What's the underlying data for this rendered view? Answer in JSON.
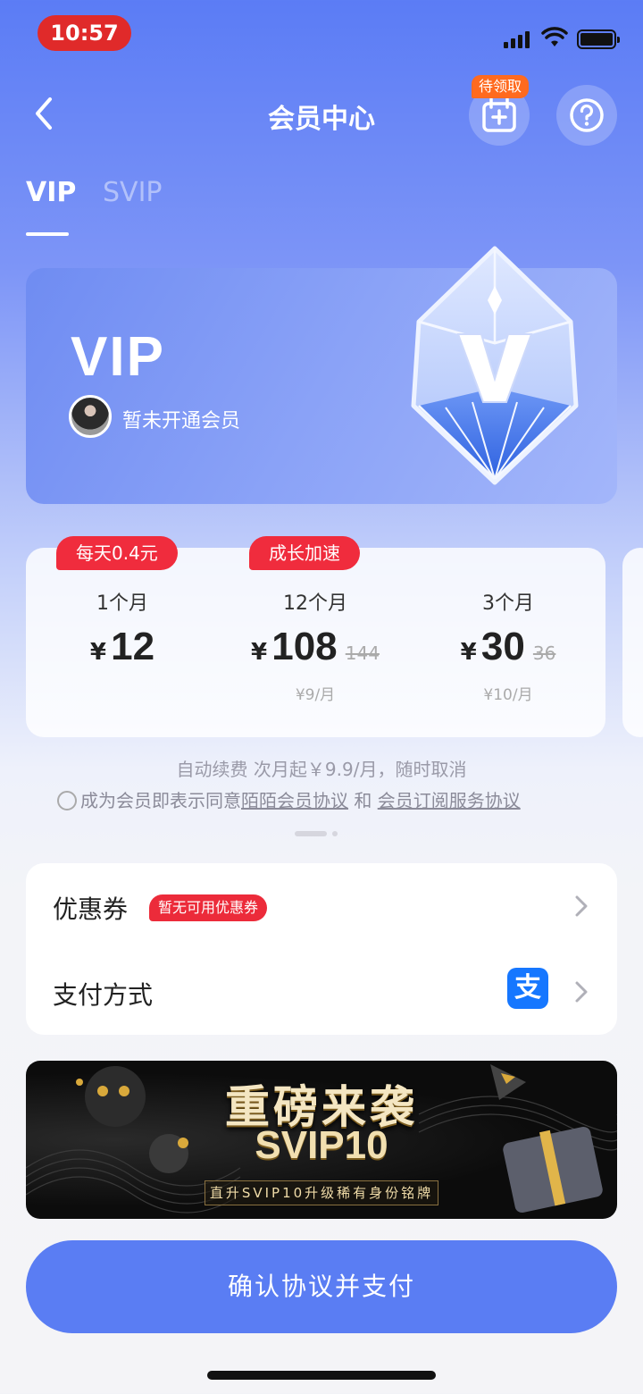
{
  "status_bar": {
    "time": "10:57"
  },
  "header": {
    "title": "会员中心",
    "calendar_badge": "待领取"
  },
  "tabs": [
    {
      "label": "VIP"
    },
    {
      "label": "SVIP"
    }
  ],
  "vip_card": {
    "title": "VIP",
    "member_status": "暂未开通会员"
  },
  "plans": [
    {
      "badge": "每天0.4元",
      "duration": "1个月",
      "currency": "¥",
      "price": "12",
      "original_price": "",
      "monthly": ""
    },
    {
      "badge": "成长加速",
      "duration": "12个月",
      "currency": "¥",
      "price": "108",
      "original_price": "144",
      "monthly": "¥9/月"
    },
    {
      "badge": "",
      "duration": "3个月",
      "currency": "¥",
      "price": "30",
      "original_price": "36",
      "monthly": "¥10/月"
    }
  ],
  "renewal_note": "自动续费 次月起￥9.9/月，随时取消",
  "agreement": {
    "prefix": "成为会员即表示同意",
    "link1": "陌陌会员协议",
    "conjunction": " 和 ",
    "link2": "会员订阅服务协议"
  },
  "options": {
    "coupon_label": "优惠券",
    "coupon_tag": "暂无可用优惠券",
    "payment_label": "支付方式",
    "payment_icon_glyph": "支"
  },
  "banner": {
    "headline": "重磅来袭",
    "subheadline": "SVIP10",
    "caption": "直升SVIP10升级稀有身份铭牌"
  },
  "confirm_button": "确认协议并支付",
  "colors": {
    "accent": "#5a7df3",
    "badge_red": "#f02c3d",
    "calendar_badge": "#ff6a1f",
    "alipay_blue": "#1677ff"
  },
  "icons": [
    "back-arrow-icon",
    "calendar-add-icon",
    "help-icon",
    "chevron-right-icon",
    "alipay-icon",
    "vip-gem-icon"
  ]
}
